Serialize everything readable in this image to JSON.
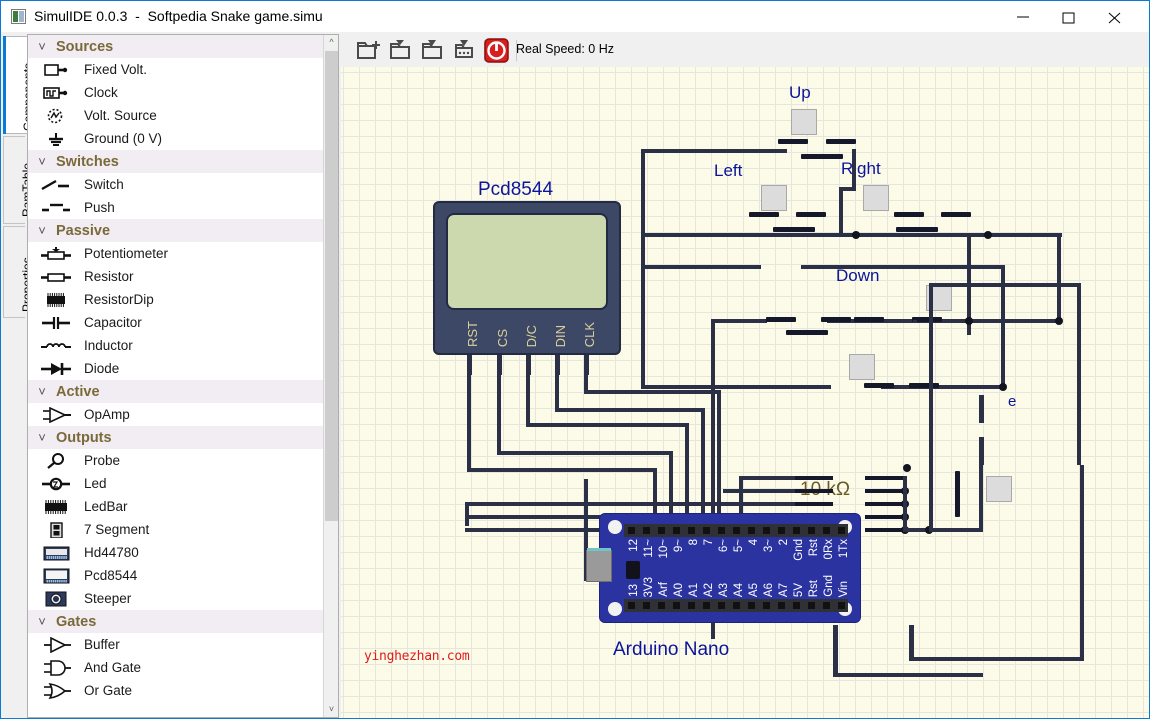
{
  "window": {
    "title": "SimulIDE 0.0.3  -  Softpedia Snake game.simu",
    "minimize_label": "minimize-icon",
    "maximize_label": "maximize-icon",
    "close_label": "close-icon"
  },
  "vtabs": [
    {
      "label": "Components",
      "selected": true
    },
    {
      "label": "RamTable",
      "selected": false
    },
    {
      "label": "Properties",
      "selected": false
    }
  ],
  "toolbar": {
    "buttons": [
      {
        "name": "new-circuit-button",
        "icon": "folder-new-icon"
      },
      {
        "name": "open-circuit-button",
        "icon": "folder-open-icon"
      },
      {
        "name": "save-circuit-button",
        "icon": "folder-save-icon"
      },
      {
        "name": "save-as-button",
        "icon": "folder-save-as-icon"
      },
      {
        "name": "power-button",
        "icon": "power-icon"
      }
    ],
    "speed_text": "Real Speed: 0 Hz",
    "power_color": "#d81f1f"
  },
  "components": [
    {
      "group": "Sources",
      "items": [
        {
          "label": "Fixed Volt.",
          "icon": "fixed-volt-icon"
        },
        {
          "label": "Clock",
          "icon": "clock-icon"
        },
        {
          "label": "Volt. Source",
          "icon": "volt-source-icon"
        },
        {
          "label": "Ground (0 V)",
          "icon": "ground-icon"
        }
      ]
    },
    {
      "group": "Switches",
      "items": [
        {
          "label": "Switch",
          "icon": "switch-icon"
        },
        {
          "label": "Push",
          "icon": "push-icon"
        }
      ]
    },
    {
      "group": "Passive",
      "items": [
        {
          "label": "Potentiometer",
          "icon": "potentiometer-icon"
        },
        {
          "label": "Resistor",
          "icon": "resistor-icon"
        },
        {
          "label": "ResistorDip",
          "icon": "resistordip-icon"
        },
        {
          "label": "Capacitor",
          "icon": "capacitor-icon"
        },
        {
          "label": "Inductor",
          "icon": "inductor-icon"
        },
        {
          "label": "Diode",
          "icon": "diode-icon"
        }
      ]
    },
    {
      "group": "Active",
      "items": [
        {
          "label": "OpAmp",
          "icon": "opamp-icon"
        }
      ]
    },
    {
      "group": "Outputs",
      "items": [
        {
          "label": "Probe",
          "icon": "probe-icon"
        },
        {
          "label": "Led",
          "icon": "led-icon"
        },
        {
          "label": "LedBar",
          "icon": "ledbar-icon"
        },
        {
          "label": "7 Segment",
          "icon": "seven-segment-icon"
        },
        {
          "label": "Hd44780",
          "icon": "hd44780-icon"
        },
        {
          "label": "Pcd8544",
          "icon": "pcd8544-icon"
        },
        {
          "label": "Steeper",
          "icon": "steeper-icon"
        }
      ]
    },
    {
      "group": "Gates",
      "items": [
        {
          "label": "Buffer",
          "icon": "buffer-icon"
        },
        {
          "label": "And Gate",
          "icon": "and-gate-icon"
        },
        {
          "label": "Or Gate",
          "icon": "or-gate-icon"
        }
      ]
    }
  ],
  "circuit": {
    "lcd": {
      "title": "Pcd8544",
      "pins": [
        "RST",
        "CS",
        "D/C",
        "DIN",
        "CLK"
      ]
    },
    "buttons": [
      {
        "label": "Up"
      },
      {
        "label": "Left"
      },
      {
        "label": "Right"
      },
      {
        "label": "Down"
      }
    ],
    "resistor": {
      "label": "10 kΩ"
    },
    "extra_label": "e",
    "board": {
      "title": "Arduino Nano",
      "top_pins": [
        "12",
        "11~",
        "10~",
        "9~",
        "8",
        "7",
        "6~",
        "5~",
        "4",
        "3~",
        "2",
        "Gnd",
        "Rst",
        "0Rx",
        "1Tx"
      ],
      "bottom_pins": [
        "13",
        "3V3",
        "Arf",
        "A0",
        "A1",
        "A2",
        "A3",
        "A4",
        "A5",
        "A6",
        "A7",
        "5V",
        "Rst",
        "Gnd",
        "Vin"
      ]
    },
    "watermark": "yinghezhan.com"
  }
}
